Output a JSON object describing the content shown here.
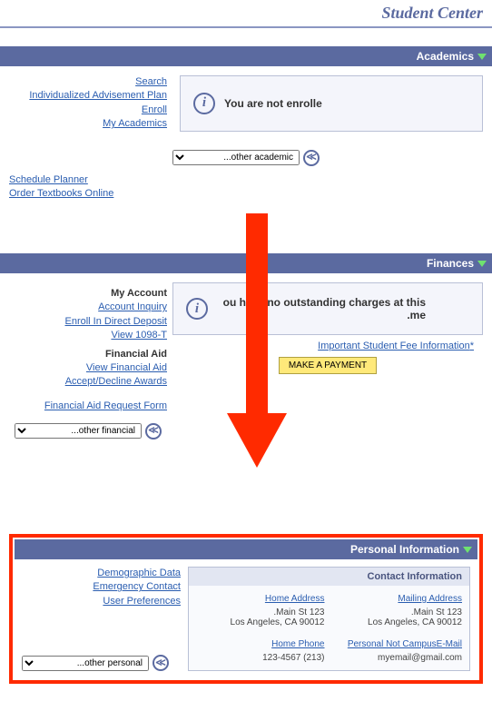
{
  "page_title": "Student Center",
  "academics": {
    "header": "Academics",
    "links": [
      "Search",
      "Individualized Advisement Plan",
      "Enroll",
      "My Academics"
    ],
    "info_text": "You are not enrolle",
    "dropdown": "other academic...",
    "extra_links": [
      "Schedule Planner",
      "Order Textbooks Online"
    ]
  },
  "finances": {
    "header": "Finances",
    "account_head": "My Account",
    "account_links": [
      "Account Inquiry",
      "Enroll In Direct Deposit",
      "View 1098-T"
    ],
    "finaid_head": "Financial Aid",
    "finaid_links": [
      "View Financial Aid",
      "Accept/Decline Awards"
    ],
    "request_link": "Financial Aid Request Form",
    "info_text": "ou have no outstanding charges at this me.",
    "fee_link": "*Important Student Fee Information",
    "payment_button": "MAKE A PAYMENT",
    "dropdown": "other financial..."
  },
  "personal": {
    "header": "Personal Information",
    "links": [
      "Demographic Data",
      "Emergency Contact",
      "User Preferences"
    ],
    "dropdown": "other personal...",
    "card_title": "Contact Information",
    "home_addr_label": "Home Address",
    "home_addr": "123 Main St.\nLos Angeles, CA 90012",
    "mail_addr_label": "Mailing Address",
    "mail_addr": "123 Main St.\nLos Angeles, CA 90012",
    "home_phone_label": "Home Phone",
    "home_phone": "(213) 123-4567",
    "email_label": "Personal Not CampusE-Mail",
    "email": "myemail@gmail.com"
  }
}
